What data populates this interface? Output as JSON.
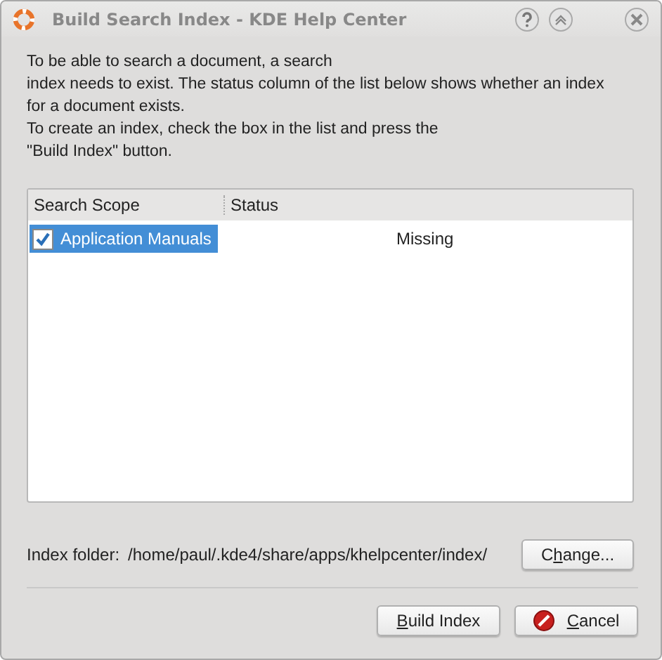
{
  "window": {
    "title": "Build Search Index - KDE Help Center"
  },
  "intro": [
    "To be able to search a document, a search",
    "index needs to exist. The status column of the list below shows whether an index",
    "for a document exists.",
    "To create an index, check the box in the list and press the",
    "\"Build Index\" button."
  ],
  "table": {
    "columns": [
      "Search Scope",
      "Status"
    ],
    "rows": [
      {
        "scope": "Application Manuals",
        "status": "Missing",
        "checked": true,
        "selected": true
      }
    ]
  },
  "index_folder": {
    "label": "Index folder:",
    "path": "/home/paul/.kde4/share/apps/khelpcenter/index/",
    "button": {
      "pre": "C",
      "key": "h",
      "post": "ange..."
    }
  },
  "buttons": [
    {
      "kind": "build",
      "key": "B",
      "post": "uild Index"
    },
    {
      "kind": "cancel",
      "key": "C",
      "post": "ancel"
    }
  ]
}
